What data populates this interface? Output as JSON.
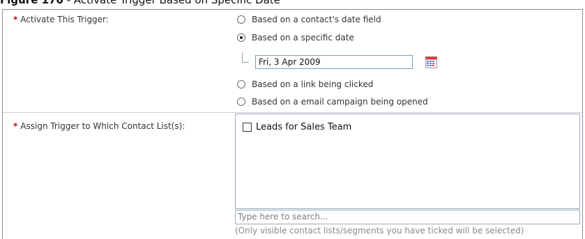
{
  "caption": {
    "figure_label": "Figure 170",
    "separator": " - ",
    "text": "Activate Trigger Based on Specific Date"
  },
  "activate_trigger": {
    "required_marker": "*",
    "label": "Activate This Trigger:",
    "options": [
      {
        "label": "Based on a contact's date field",
        "selected": false
      },
      {
        "label": "Based on a specific date",
        "selected": true
      },
      {
        "label": "Based on a link being clicked",
        "selected": false
      },
      {
        "label": "Based on a email campaign being opened",
        "selected": false
      }
    ],
    "date_value": "Fri, 3 Apr 2009",
    "calendar_icon": "calendar-icon"
  },
  "assign_list": {
    "required_marker": "*",
    "label": "Assign Trigger to Which Contact List(s):",
    "items": [
      {
        "label": "Leads for Sales Team",
        "checked": false
      }
    ],
    "search_placeholder": "Type here to search...",
    "hint": "(Only visible contact lists/segments you have ticked will be selected)"
  },
  "colors": {
    "required": "#cc0000",
    "border": "#8c8c8c",
    "input_border": "#7f9db9"
  }
}
